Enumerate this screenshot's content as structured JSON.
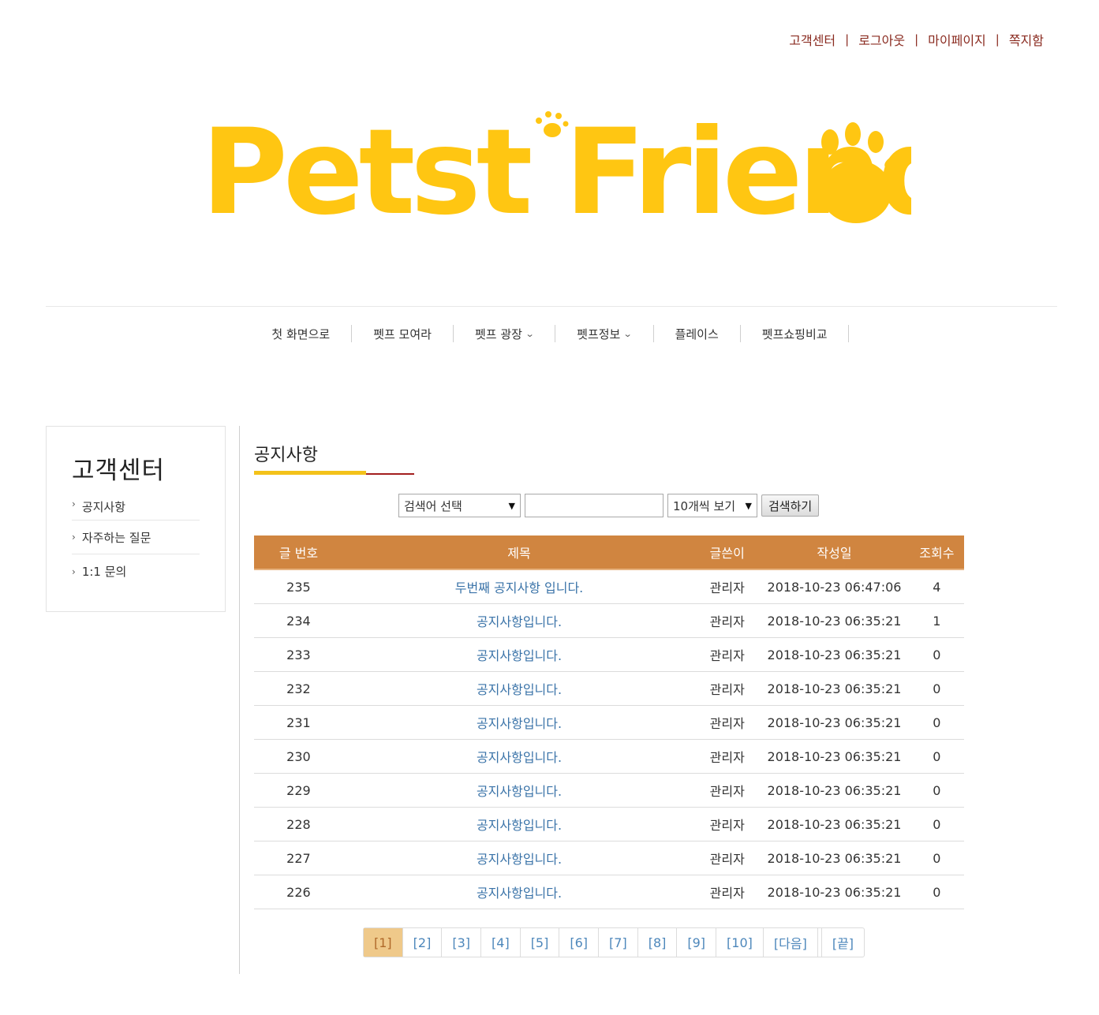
{
  "top_links": [
    "고객센터",
    "로그아웃",
    "마이페이지",
    "쪽지함"
  ],
  "logo": {
    "text": "Petst Friends",
    "color": "#ffc612"
  },
  "nav": [
    {
      "label": "첫 화면으로",
      "dropdown": false
    },
    {
      "label": "펫프 모여라",
      "dropdown": false
    },
    {
      "label": "펫프 광장",
      "dropdown": true
    },
    {
      "label": "펫프정보",
      "dropdown": true
    },
    {
      "label": "플레이스",
      "dropdown": false
    },
    {
      "label": "펫프쇼핑비교",
      "dropdown": false
    }
  ],
  "sidebar": {
    "title": "고객센터",
    "items": [
      "공지사항",
      "자주하는 질문",
      "1:1 문의"
    ]
  },
  "content": {
    "title": "공지사항",
    "search": {
      "field_select": "검색어 선택",
      "query": "",
      "page_size_select": "10개씩 보기",
      "submit": "검색하기"
    },
    "columns": [
      "글 번호",
      "제목",
      "글쓴이",
      "작성일",
      "조회수"
    ],
    "rows": [
      {
        "no": "235",
        "subject": "두번째 공지사항 입니다.",
        "writer": "관리자",
        "date": "2018-10-23 06:47:06",
        "views": "4"
      },
      {
        "no": "234",
        "subject": "공지사항입니다.",
        "writer": "관리자",
        "date": "2018-10-23 06:35:21",
        "views": "1"
      },
      {
        "no": "233",
        "subject": "공지사항입니다.",
        "writer": "관리자",
        "date": "2018-10-23 06:35:21",
        "views": "0"
      },
      {
        "no": "232",
        "subject": "공지사항입니다.",
        "writer": "관리자",
        "date": "2018-10-23 06:35:21",
        "views": "0"
      },
      {
        "no": "231",
        "subject": "공지사항입니다.",
        "writer": "관리자",
        "date": "2018-10-23 06:35:21",
        "views": "0"
      },
      {
        "no": "230",
        "subject": "공지사항입니다.",
        "writer": "관리자",
        "date": "2018-10-23 06:35:21",
        "views": "0"
      },
      {
        "no": "229",
        "subject": "공지사항입니다.",
        "writer": "관리자",
        "date": "2018-10-23 06:35:21",
        "views": "0"
      },
      {
        "no": "228",
        "subject": "공지사항입니다.",
        "writer": "관리자",
        "date": "2018-10-23 06:35:21",
        "views": "0"
      },
      {
        "no": "227",
        "subject": "공지사항입니다.",
        "writer": "관리자",
        "date": "2018-10-23 06:35:21",
        "views": "0"
      },
      {
        "no": "226",
        "subject": "공지사항입니다.",
        "writer": "관리자",
        "date": "2018-10-23 06:35:21",
        "views": "0"
      }
    ],
    "pagination": {
      "pages": [
        "[1]",
        "[2]",
        "[3]",
        "[4]",
        "[5]",
        "[6]",
        "[7]",
        "[8]",
        "[9]",
        "[10]"
      ],
      "next": "[다음]",
      "last": "[끝]",
      "current": "[1]"
    }
  },
  "colors": {
    "header_bg": "#d08540",
    "link": "#3a73a8",
    "accent_red": "#8a2b20",
    "active_page": "#efc98a"
  }
}
